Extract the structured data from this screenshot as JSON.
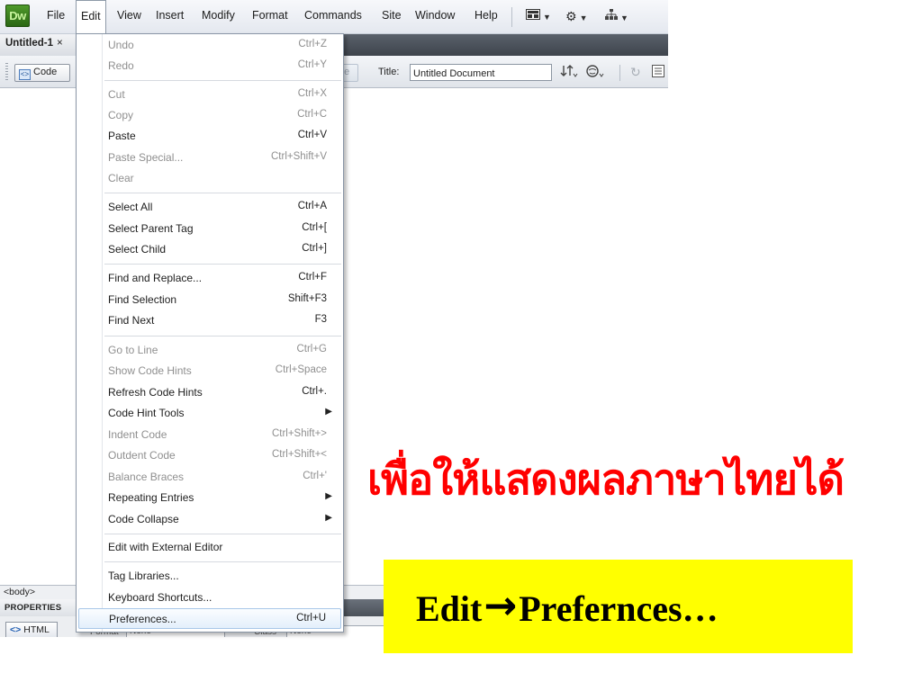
{
  "app": {
    "logo": "Dw",
    "menus": [
      "File",
      "Edit",
      "View",
      "Insert",
      "Modify",
      "Format",
      "Commands",
      "Site",
      "Window",
      "Help"
    ],
    "active_menu": "Edit",
    "toolbar_icons": [
      "layout-icon",
      "gear-icon",
      "sitemap-icon"
    ]
  },
  "document": {
    "tab_label": "Untitled-1",
    "tab_close": "×",
    "code_button": "Code",
    "design_button_partial": "de",
    "title_label": "Title:",
    "title_value": "Untitled Document"
  },
  "statusbar": {
    "tag": "<body>"
  },
  "properties": {
    "header": "PROPERTIES",
    "html_button": "HTML",
    "format_label": "Format",
    "format_value": "None",
    "class_label": "Class",
    "class_value": "None"
  },
  "edit_menu": {
    "items": [
      {
        "label": "Undo",
        "shortcut": "Ctrl+Z",
        "enabled": false
      },
      {
        "label": "Redo",
        "shortcut": "Ctrl+Y",
        "enabled": false
      },
      {
        "label": "Cut",
        "shortcut": "Ctrl+X",
        "enabled": false
      },
      {
        "label": "Copy",
        "shortcut": "Ctrl+C",
        "enabled": false
      },
      {
        "label": "Paste",
        "shortcut": "Ctrl+V",
        "enabled": true
      },
      {
        "label": "Paste Special...",
        "shortcut": "Ctrl+Shift+V",
        "enabled": false
      },
      {
        "label": "Clear",
        "shortcut": "",
        "enabled": false
      },
      {
        "label": "Select All",
        "shortcut": "Ctrl+A",
        "enabled": true
      },
      {
        "label": "Select Parent Tag",
        "shortcut": "Ctrl+[",
        "enabled": true
      },
      {
        "label": "Select Child",
        "shortcut": "Ctrl+]",
        "enabled": true
      },
      {
        "label": "Find and Replace...",
        "shortcut": "Ctrl+F",
        "enabled": true
      },
      {
        "label": "Find Selection",
        "shortcut": "Shift+F3",
        "enabled": true
      },
      {
        "label": "Find Next",
        "shortcut": "F3",
        "enabled": true
      },
      {
        "label": "Go to Line",
        "shortcut": "Ctrl+G",
        "enabled": false
      },
      {
        "label": "Show Code Hints",
        "shortcut": "Ctrl+Space",
        "enabled": false
      },
      {
        "label": "Refresh Code Hints",
        "shortcut": "Ctrl+.",
        "enabled": true
      },
      {
        "label": "Code Hint Tools",
        "shortcut": "",
        "enabled": true,
        "submenu": true
      },
      {
        "label": "Indent Code",
        "shortcut": "Ctrl+Shift+>",
        "enabled": false
      },
      {
        "label": "Outdent Code",
        "shortcut": "Ctrl+Shift+<",
        "enabled": false
      },
      {
        "label": "Balance Braces",
        "shortcut": "Ctrl+'",
        "enabled": false
      },
      {
        "label": "Repeating Entries",
        "shortcut": "",
        "enabled": true,
        "submenu": true
      },
      {
        "label": "Code Collapse",
        "shortcut": "",
        "enabled": true,
        "submenu": true
      },
      {
        "label": "Edit with External Editor",
        "shortcut": "",
        "enabled": true
      },
      {
        "label": "Tag Libraries...",
        "shortcut": "",
        "enabled": true
      },
      {
        "label": "Keyboard Shortcuts...",
        "shortcut": "",
        "enabled": true
      },
      {
        "label": "Preferences...",
        "shortcut": "Ctrl+U",
        "enabled": true,
        "highlighted": true
      }
    ]
  },
  "overlay": {
    "thai_text": "เพื่อให้แสดงผลภาษาไทยได้",
    "callout_left": "Edit",
    "callout_arrow": "→",
    "callout_right": "Prefernces…",
    "callout_bg": "#ffff00",
    "thai_color": "#ff0000"
  }
}
